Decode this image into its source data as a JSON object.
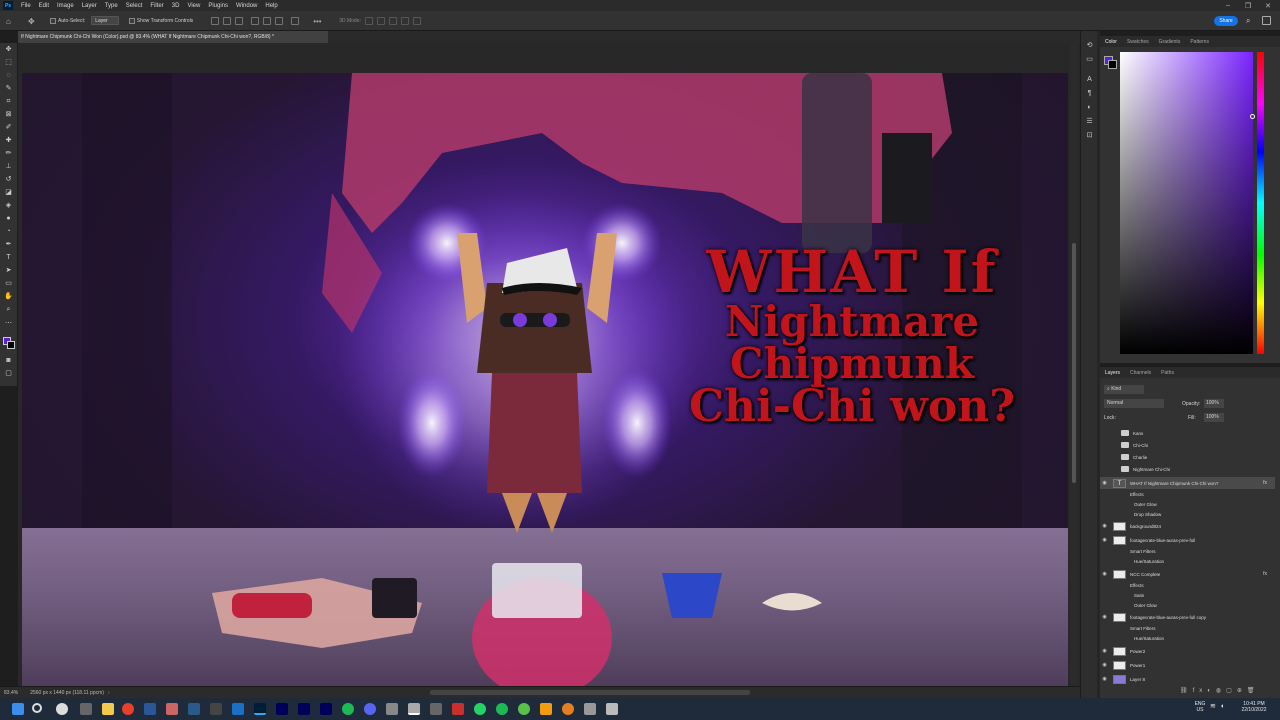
{
  "menu": {
    "app_logo": "Ps",
    "items": [
      "File",
      "Edit",
      "Image",
      "Layer",
      "Type",
      "Select",
      "Filter",
      "3D",
      "View",
      "Plugins",
      "Window",
      "Help"
    ]
  },
  "options_bar": {
    "auto_select_label": "Auto-Select:",
    "auto_select_value": "Layer",
    "show_transform_label": "Show Transform Controls",
    "mode_label": "3D Mode:",
    "share_label": "Share"
  },
  "document_tab": {
    "title": "If Nightmare Chipmunk Chi-Chi Won (Color).psd @ 83.4% (WHAT If Nightmare Chipmunk Chi-Chi won?, RGB/8) *"
  },
  "artwork": {
    "title_line1": "WHAT If",
    "title_line2": "Nightmare Chipmunk",
    "title_line3": "Chi-Chi won?"
  },
  "status_bar": {
    "zoom": "83.4%",
    "doc_info": "2560 px x 1440 px (118.11 ppcm)"
  },
  "color_panel": {
    "tabs": [
      "Color",
      "Swatches",
      "Gradients",
      "Patterns"
    ],
    "active_tab": "Color",
    "foreground_color": "#5a1fd6",
    "background_color": "#000000"
  },
  "layers_panel": {
    "tabs": [
      "Layers",
      "Channels",
      "Paths"
    ],
    "filter_label": "Kind",
    "blend_mode": "Normal",
    "opacity_label": "Opacity:",
    "opacity_value": "100%",
    "lock_label": "Lock:",
    "fill_label": "Fill:",
    "fill_value": "100%",
    "rows": [
      {
        "label": "Kans",
        "kind": "group",
        "visible": false
      },
      {
        "label": "Chi-Chi",
        "kind": "group",
        "visible": false
      },
      {
        "label": "Charlie",
        "kind": "group",
        "visible": false
      },
      {
        "label": "Nightmare Chi-Chi",
        "kind": "group",
        "visible": false
      },
      {
        "label": "WHAT If Nightmare Chipmunk Chi-Chi won?",
        "kind": "text",
        "visible": true,
        "selected": true,
        "fx": true
      },
      {
        "label": "Effects",
        "kind": "effects"
      },
      {
        "label": "Outer Glow",
        "kind": "effect"
      },
      {
        "label": "Drop Shadow",
        "kind": "effect"
      },
      {
        "label": "background824",
        "kind": "layer",
        "visible": true
      },
      {
        "label": "footagecrate-blue-auras-prev-full",
        "kind": "layer",
        "visible": true
      },
      {
        "label": "Smart Filters",
        "kind": "filter"
      },
      {
        "label": "Hue/Saturation",
        "kind": "effect"
      },
      {
        "label": "NCC Complete",
        "kind": "layer",
        "visible": true,
        "fx": true
      },
      {
        "label": "Effects",
        "kind": "effects"
      },
      {
        "label": "Satin",
        "kind": "effect"
      },
      {
        "label": "Outer Glow",
        "kind": "effect"
      },
      {
        "label": "footagecrate-blue-auras-prev-full copy",
        "kind": "layer",
        "visible": true
      },
      {
        "label": "Smart Filters",
        "kind": "filter"
      },
      {
        "label": "Hue/Saturation",
        "kind": "effect"
      },
      {
        "label": "Power2",
        "kind": "layer",
        "visible": true
      },
      {
        "label": "Power1",
        "kind": "layer",
        "visible": true
      },
      {
        "label": "Layer 8",
        "kind": "layer",
        "visible": true
      }
    ]
  },
  "taskbar": {
    "language": "ENG",
    "region": "US",
    "time": "10:41 PM",
    "date": "22/10/2022"
  }
}
